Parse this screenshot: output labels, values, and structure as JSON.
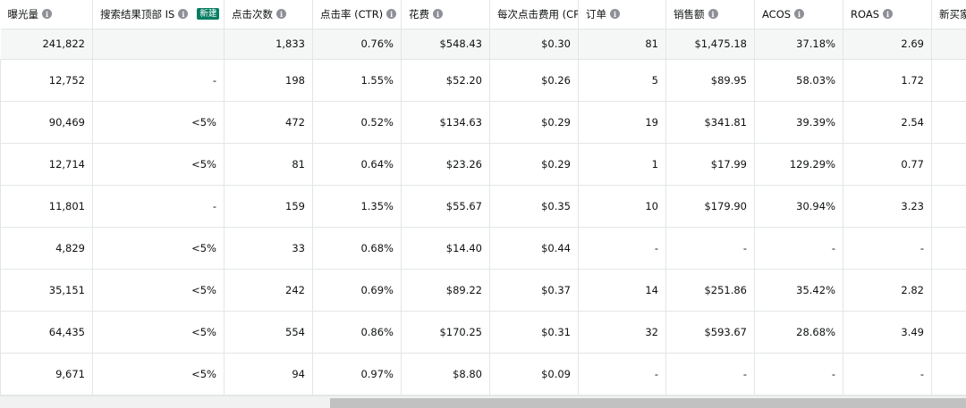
{
  "headers": [
    {
      "label": "曝光量",
      "icon": "info-icon"
    },
    {
      "label": "搜索结果顶部 IS",
      "icon": "info-icon",
      "badge": "新建"
    },
    {
      "label": "点击次数",
      "icon": "info-icon"
    },
    {
      "label": "点击率 (CTR)",
      "icon": "info-icon"
    },
    {
      "label": "花费",
      "icon": "info-icon"
    },
    {
      "label": "每次点击费用 (CPC",
      "icon": null
    },
    {
      "label": "订单",
      "icon": "info-icon"
    },
    {
      "label": "销售额",
      "icon": "info-icon"
    },
    {
      "label": "ACOS",
      "icon": "info-icon"
    },
    {
      "label": "ROAS",
      "icon": "info-icon"
    },
    {
      "label": "新买家",
      "icon": null
    }
  ],
  "summary": [
    "241,822",
    "",
    "1,833",
    "0.76%",
    "$548.43",
    "$0.30",
    "81",
    "$1,475.18",
    "37.18%",
    "2.69",
    ""
  ],
  "rows": [
    [
      "12,752",
      "-",
      "198",
      "1.55%",
      "$52.20",
      "$0.26",
      "5",
      "$89.95",
      "58.03%",
      "1.72",
      ""
    ],
    [
      "90,469",
      "<5%",
      "472",
      "0.52%",
      "$134.63",
      "$0.29",
      "19",
      "$341.81",
      "39.39%",
      "2.54",
      ""
    ],
    [
      "12,714",
      "<5%",
      "81",
      "0.64%",
      "$23.26",
      "$0.29",
      "1",
      "$17.99",
      "129.29%",
      "0.77",
      ""
    ],
    [
      "11,801",
      "-",
      "159",
      "1.35%",
      "$55.67",
      "$0.35",
      "10",
      "$179.90",
      "30.94%",
      "3.23",
      ""
    ],
    [
      "4,829",
      "<5%",
      "33",
      "0.68%",
      "$14.40",
      "$0.44",
      "-",
      "-",
      "-",
      "-",
      ""
    ],
    [
      "35,151",
      "<5%",
      "242",
      "0.69%",
      "$89.22",
      "$0.37",
      "14",
      "$251.86",
      "35.42%",
      "2.82",
      ""
    ],
    [
      "64,435",
      "<5%",
      "554",
      "0.86%",
      "$170.25",
      "$0.31",
      "32",
      "$593.67",
      "28.68%",
      "3.49",
      ""
    ],
    [
      "9,671",
      "<5%",
      "94",
      "0.97%",
      "$8.80",
      "$0.09",
      "-",
      "-",
      "-",
      "-",
      ""
    ]
  ],
  "colors": {
    "header_bg": "#ffffff",
    "summary_bg": "#f5f6f6",
    "border": "#e3e6e6",
    "badge_bg": "#067d62",
    "info_icon": "#8d9096",
    "scrollbar_thumb": "#c1c1c1"
  }
}
